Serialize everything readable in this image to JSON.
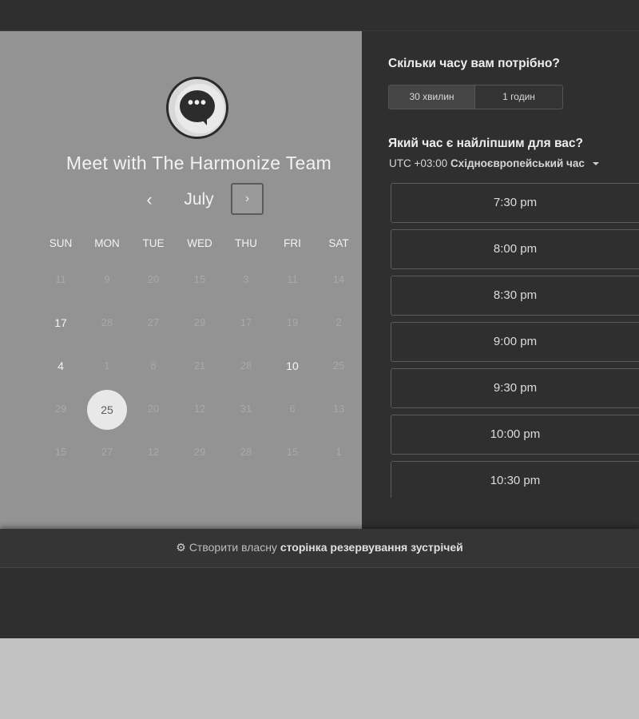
{
  "header": {
    "title": ""
  },
  "profile": {
    "team_title": "Meet with The Harmonize Team",
    "logo_icon": "chat-bubble-icon"
  },
  "calendar": {
    "month": "July",
    "prev_icon": "‹",
    "next_icon": "›",
    "weekdays": [
      "SUN",
      "MON",
      "TUE",
      "WED",
      "THU",
      "FRI",
      "SAT"
    ],
    "weeks": [
      [
        "11",
        "9",
        "20",
        "15",
        "3",
        "11",
        "14"
      ],
      [
        "17",
        "28",
        "27",
        "29",
        "17",
        "19",
        "2"
      ],
      [
        "4",
        "1",
        "8",
        "21",
        "28",
        "10",
        "25"
      ],
      [
        "29",
        "25",
        "20",
        "12",
        "31",
        "6",
        "13"
      ],
      [
        "15",
        "27",
        "12",
        "29",
        "28",
        "15",
        "1"
      ]
    ],
    "selected_day": "25"
  },
  "duration": {
    "question": "Скільки часу вам потрібно?",
    "options": [
      "30 хвилин",
      "1 годин"
    ]
  },
  "time": {
    "question": "Який час є найліпшим для вас?",
    "timezone_prefix": "UTC +03:00",
    "timezone_name": "Східноєвропейський час",
    "slots": [
      "7:30 pm",
      "8:00 pm",
      "8:30 pm",
      "9:00 pm",
      "9:30 pm",
      "10:00 pm",
      "10:30 pm"
    ]
  },
  "footer": {
    "prefix": "Створити власну",
    "link": "сторінка резервування зустрічей",
    "icon": "hubspot-sprocket-icon"
  },
  "colors": {
    "panel_left": "#939393",
    "panel_right": "#2f2f2f",
    "selected_day_bg": "#e8e8e8"
  }
}
